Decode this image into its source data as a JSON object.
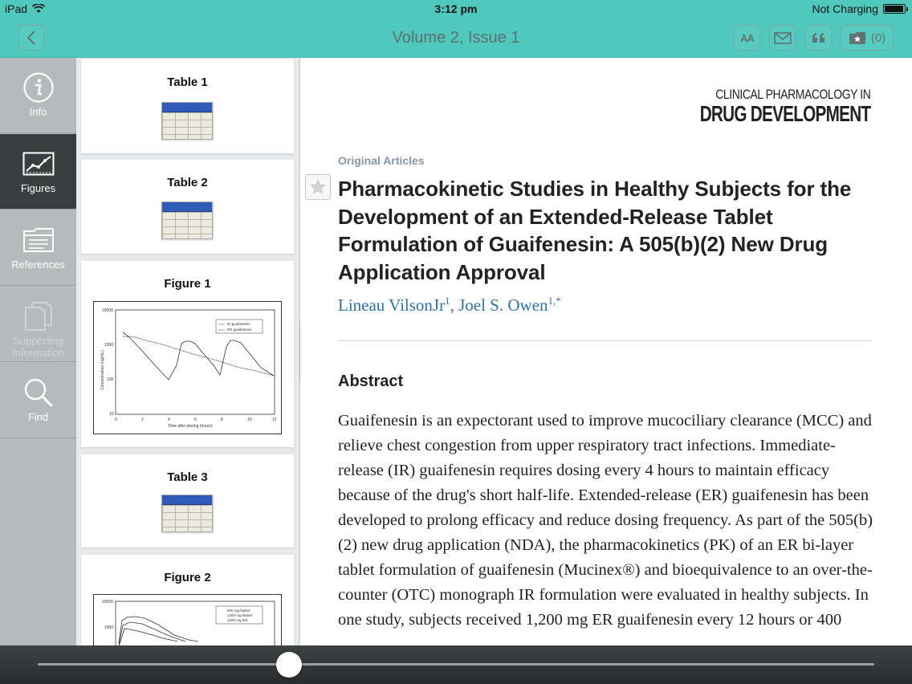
{
  "status": {
    "device": "iPad",
    "time": "3:12 pm",
    "charging": "Not Charging"
  },
  "nav": {
    "title": "Volume 2, Issue 1",
    "font_size_label": "AA",
    "bookmarks_label": "(0)"
  },
  "sidebar": {
    "items": [
      {
        "label": "Info",
        "icon": "info-icon",
        "state": "normal"
      },
      {
        "label": "Figures",
        "icon": "figures-chart-icon",
        "state": "active"
      },
      {
        "label": "References",
        "icon": "references-folder-icon",
        "state": "normal"
      },
      {
        "label": "Supporting Information",
        "icon": "supporting-info-documents-icon",
        "state": "disabled"
      },
      {
        "label": "Find",
        "icon": "search-icon",
        "state": "normal"
      }
    ]
  },
  "thumbnails": [
    {
      "title": "Table 1",
      "kind": "table"
    },
    {
      "title": "Table 2",
      "kind": "table"
    },
    {
      "title": "Figure 1",
      "kind": "figure"
    },
    {
      "title": "Table 3",
      "kind": "table"
    },
    {
      "title": "Figure 2",
      "kind": "figure"
    }
  ],
  "figure1": {
    "xlabel": "Time after dosing (hours)",
    "ylabel": "Concentration (ng/mL)",
    "yticks": [
      "10000",
      "1000",
      "100",
      "10"
    ],
    "xticks": [
      "0",
      "2",
      "4",
      "6",
      "8",
      "10",
      "12"
    ],
    "legend": [
      "IR guaifenesin",
      "ER guaifenesin"
    ]
  },
  "figure2": {
    "yticks": [
      "10000",
      "1000"
    ],
    "legend": [
      "600 mg fasted",
      "1200 mg fasted",
      "1200 mg fed"
    ]
  },
  "article": {
    "journal_line1": "CLINICAL PHARMACOLOGY IN",
    "journal_line2": "DRUG DEVELOPMENT",
    "section": "Original Articles",
    "title": "Pharmacokinetic Studies in Healthy Subjects for the Development of an Extended-Release Tablet Formulation of Guaifenesin: A 505(b)(2) New Drug Application Approval",
    "author1": "Lineau VilsonJr",
    "author1_sup": "1",
    "author_sep": ", ",
    "author2": "Joel S. Owen",
    "author2_sup": "1,*",
    "abstract_heading": "Abstract",
    "abstract_text": "Guaifenesin is an expectorant used to improve mucociliary clearance (MCC) and relieve chest congestion from upper respiratory tract infections. Immediate-release (IR) guaifenesin requires dosing every 4 hours to maintain efficacy because of the drug's short half-life. Extended-release (ER) guaifenesin has been developed to prolong efficacy and reduce dosing frequency. As part of the 505(b)(2) new drug application (NDA), the pharmacokinetics (PK) of an ER bi-layer tablet formulation of guaifenesin (Mucinex®) and bioequivalence to an over-the-counter (OTC) monograph IR formulation were evaluated in healthy subjects. In one study, subjects received 1,200 mg ER guaifenesin every 12 hours or 400"
  },
  "reader": {
    "progress": 0.3
  }
}
